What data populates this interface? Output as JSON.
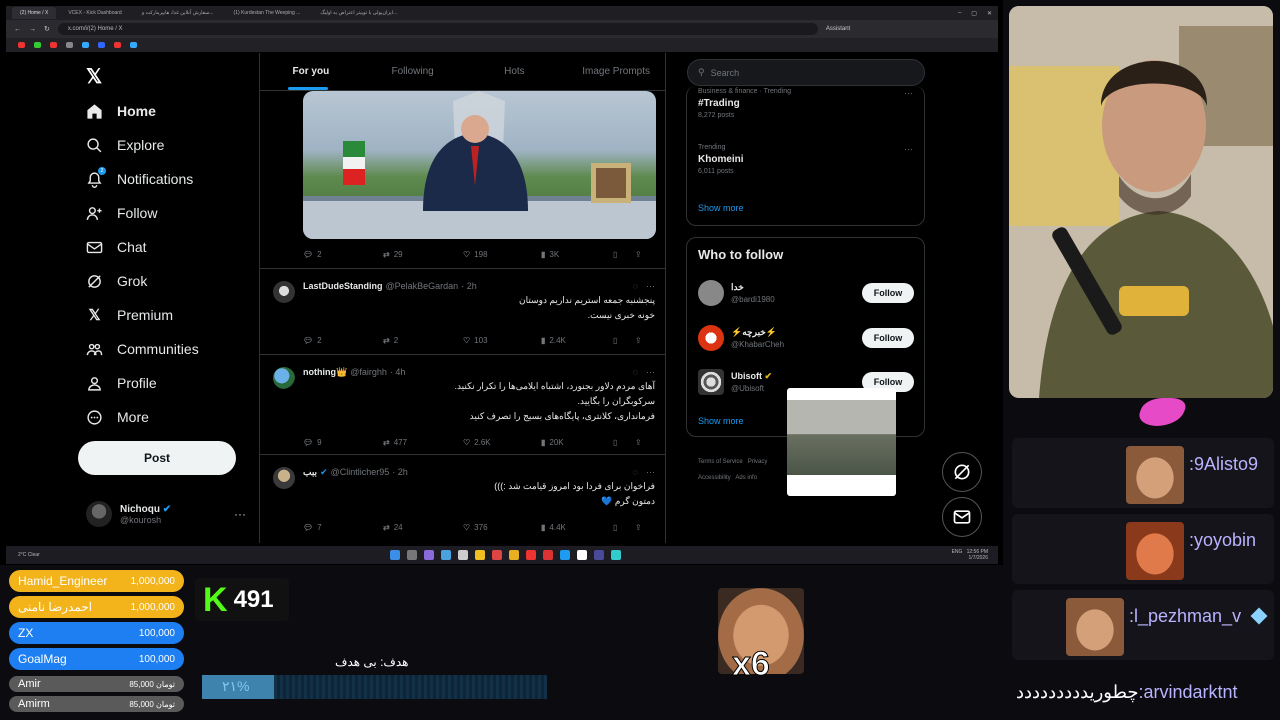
{
  "browser": {
    "tabs": [
      "(2) Home / X",
      "VCEX - Kick Dashboard",
      "سفارش آنلاین غذا، هایپرمارکت و...",
      "(1) Kurdestan The Weeping ...",
      "ایران‌پولی با توییتر اعتراض به اولیگ..."
    ],
    "url": "x.com/i/(2) Home / X",
    "assistant": "Assistant",
    "window_controls": [
      "–",
      "▢",
      "✕"
    ]
  },
  "x": {
    "nav": [
      {
        "label": "Home",
        "icon": "home-icon"
      },
      {
        "label": "Explore",
        "icon": "search-icon"
      },
      {
        "label": "Notifications",
        "icon": "bell-icon"
      },
      {
        "label": "Follow",
        "icon": "person-add-icon"
      },
      {
        "label": "Chat",
        "icon": "mail-icon"
      },
      {
        "label": "Grok",
        "icon": "grok-icon"
      },
      {
        "label": "Premium",
        "icon": "x-logo-icon"
      },
      {
        "label": "Communities",
        "icon": "people-icon"
      },
      {
        "label": "Profile",
        "icon": "person-icon"
      },
      {
        "label": "More",
        "icon": "more-circle-icon"
      }
    ],
    "notification_badge": "2",
    "post_label": "Post",
    "me": {
      "name": "Nichoqu",
      "handle": "@kourosh"
    },
    "timeline_tabs": [
      "For you",
      "Following",
      "Hots",
      "Image Prompts"
    ],
    "first_actions": {
      "replies": "2",
      "reposts": "29",
      "likes": "198",
      "views": "3K"
    },
    "tweets": [
      {
        "name": "LastDudeStanding",
        "handle": "@PelakBeGardan",
        "time": "· 2h",
        "lines": [
          "پنجشنبه جمعه استریم نداریم دوستان",
          "خونه خبری نیست."
        ],
        "replies": "2",
        "reposts": "2",
        "likes": "103",
        "views": "2.4K"
      },
      {
        "name": "nothing👑",
        "handle": "@fairghh",
        "time": "· 4h",
        "lines": [
          "آهای مردم دلاور بجنورد، اشتباه ایلامی‌ها را تکرار نکنید.",
          "سرکوبگران را بگایید.",
          "فرمانداری، کلانتری، پایگاه‌های بسیج را تصرف کنید"
        ],
        "replies": "9",
        "reposts": "477",
        "likes": "2.6K",
        "views": "20K"
      },
      {
        "name": "ببب",
        "handle": "@Clintlicher95",
        "time": "· 2h",
        "lines": [
          "فراخوان برای فردا بود امروز قیامت شد :)))",
          "دمتون گرم 💙"
        ],
        "replies": "7",
        "reposts": "24",
        "likes": "376",
        "views": "4.4K"
      }
    ],
    "search_placeholder": "Search",
    "trends": [
      {
        "category": "Business & finance · Trending",
        "title": "#Trading",
        "count": "8,272 posts"
      },
      {
        "category": "Trending",
        "title": "Khomeini",
        "count": "6,011 posts"
      }
    ],
    "show_more": "Show more",
    "who_to_follow": "Who to follow",
    "accounts": [
      {
        "name": "خدا",
        "handle": "@bardi1980",
        "follow": "Follow"
      },
      {
        "name": "⚡خبرچه⚡",
        "handle": "@KhabarCheh",
        "follow": "Follow"
      },
      {
        "name": "Ubisoft",
        "handle": "@Ubisoft",
        "follow": "Follow"
      }
    ],
    "footer": [
      "Terms of Service",
      "Privacy",
      "Accessibility",
      "Ads info"
    ]
  },
  "taskbar": {
    "weather": "2°C Clear",
    "time": "12:56 PM",
    "date": "1/7/2026",
    "lang": "ENG"
  },
  "stream": {
    "donors": [
      {
        "name": "Hamid_Engineer",
        "amount": "1,000,000",
        "color": "#f2b31b"
      },
      {
        "name": "احمدرضا نامنی",
        "amount": "1,000,000",
        "color": "#f2b31b"
      },
      {
        "name": "ZX",
        "amount": "100,000",
        "color": "#1d7ff2"
      },
      {
        "name": "GoalMag",
        "amount": "100,000",
        "color": "#1d7ff2"
      }
    ],
    "small_donors": [
      {
        "name": "Amir",
        "amount": "85,000 تومان"
      },
      {
        "name": "Amirm",
        "amount": "85,000 تومان"
      }
    ],
    "kick_logo": "K",
    "viewers": "491",
    "goal_label": "هدف: بی هدف",
    "goal_percent_text": "۲۱%",
    "goal_fraction": 0.21,
    "emote_multiplier": "x6",
    "chat": [
      {
        "user": ":9Alisto9",
        "text": ""
      },
      {
        "user": ":yoyobin",
        "text": ""
      },
      {
        "user": ":l_pezhman_v",
        "text": ""
      },
      {
        "user": ":arvindarktnt",
        "text": "چطوریددددددددد"
      }
    ]
  }
}
